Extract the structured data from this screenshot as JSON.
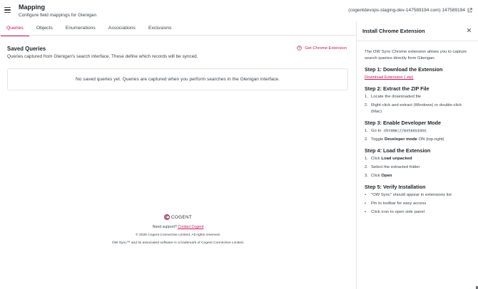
{
  "header": {
    "title": "Mapping",
    "subtitle": "Configure field mappings for Glenigan",
    "environment": "(cogentdevops-staging-dev-147589194.com) 147589194"
  },
  "tabs": [
    {
      "label": "Queries",
      "active": true
    },
    {
      "label": "Objects",
      "active": false
    },
    {
      "label": "Enumerations",
      "active": false
    },
    {
      "label": "Associations",
      "active": false
    },
    {
      "label": "Exclusions",
      "active": false
    }
  ],
  "main": {
    "section_title": "Saved Queries",
    "section_desc": "Queries captured from Glenigan's search interface. These define which records will be synced.",
    "get_extension_label": "Get Chrome Extension",
    "empty_state": "No saved queries yet. Queries are captured when you perform searches in the Glenigan interface."
  },
  "footer": {
    "logo_text": "COGENT",
    "support_prefix": "Need support?",
    "support_link": "Contact Cogent",
    "copyright": "© 2026 Cogent Connective Limited. All rights reserved.",
    "trademark": "OW Sync™ and its associated software is a trademark of Cogent Connective Limited."
  },
  "panel": {
    "title": "Install Chrome Extension",
    "intro": "The OW Sync Chrome extension allows you to capture search queries directly from Glenigan.",
    "step1": {
      "title": "Step 1: Download the Extension",
      "link": "Download Extension (.zip)"
    },
    "step2": {
      "title": "Step 2: Extract the ZIP File",
      "items": [
        "Locate the downloaded file",
        "Right-click and extract (Windows) or double-click (Mac)"
      ]
    },
    "step3": {
      "title": "Step 3: Enable Developer Mode",
      "item1_prefix": "Go to",
      "item1_code": "chrome://extensions",
      "item2_prefix": "Toggle",
      "item2_bold": "Developer mode",
      "item2_suffix": "ON (top-right)"
    },
    "step4": {
      "title": "Step 4: Load the Extension",
      "item1_prefix": "Click",
      "item1_bold": "Load unpacked",
      "item2": "Select the extracted folder",
      "item3_prefix": "Click",
      "item3_bold": "Open"
    },
    "step5": {
      "title": "Step 5: Verify Installation",
      "items": [
        "\"OW Sync\" should appear in extensions list",
        "Pin to toolbar for easy access",
        "Click icon to open side panel"
      ]
    }
  },
  "colors": {
    "accent": "#c2185b",
    "text": "#1f2328",
    "muted": "#3d434a",
    "border": "#e3e5e8"
  },
  "icons": [
    "menu-icon",
    "external-link-icon",
    "question-circle-icon",
    "close-icon",
    "cogent-logo-icon"
  ]
}
